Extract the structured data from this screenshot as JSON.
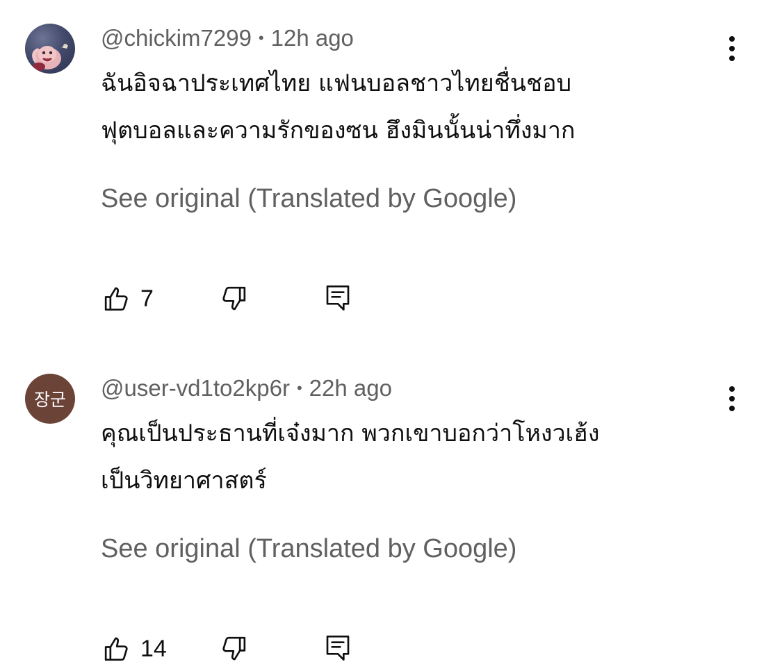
{
  "comments": [
    {
      "handle": "@chickim7299",
      "time": "12h ago",
      "text_line1": "ฉันอิจฉาประเทศไทย แฟนบอลชาวไทยชื่นชอบ",
      "text_line2": "ฟุตบอลและความรักของซน ฮึงมินนั้นน่าทึ่งมาก",
      "see_original": "See original (Translated by Google)",
      "likes": "7",
      "avatar_icon": "profile-photo-icon"
    },
    {
      "handle": "@user-vd1to2kp6r",
      "time": "22h ago",
      "avatar_text": "장군",
      "text_line1": "คุณเป็นประธานที่เจ๋งมาก พวกเขาบอกว่าโหงวเฮ้ง",
      "text_line2": "เป็นวิทยาศาสตร์",
      "see_original": "See original (Translated by Google)",
      "likes": "14",
      "avatar_color": "#6b4337"
    }
  ],
  "separator": "•",
  "icons": {
    "like": "thumbs-up-icon",
    "dislike": "thumbs-down-icon",
    "reply": "reply-comment-icon",
    "more": "more-vertical-icon"
  }
}
